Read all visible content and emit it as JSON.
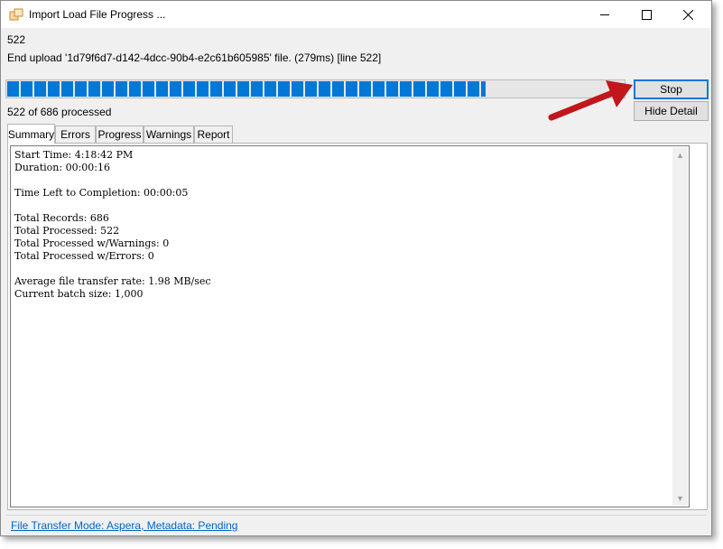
{
  "window": {
    "title": "Import Load File Progress ...",
    "icon": "app-window-icon",
    "controls": [
      "minimize-icon",
      "maximize-icon",
      "close-icon"
    ]
  },
  "status": {
    "count": "522",
    "message": "End upload '1d79f6d7-d142-4dcc-90b4-e2c61b605985' file. (279ms) [line 522]",
    "processed": "522 of 686 processed",
    "progress_fraction": 0.776,
    "progress_color": "#0078d7"
  },
  "buttons": {
    "stop": "Stop",
    "hide_detail": "Hide Detail"
  },
  "annotation": {
    "arrow_color": "#c0161c",
    "icon": "red-arrow-icon"
  },
  "tabs": [
    {
      "label": "Summary",
      "active": true
    },
    {
      "label": "Errors",
      "active": false
    },
    {
      "label": "Progress",
      "active": false
    },
    {
      "label": "Warnings",
      "active": false
    },
    {
      "label": "Report",
      "active": false
    }
  ],
  "summary": {
    "lines": [
      "Start Time: 4:18:42 PM",
      "Duration: 00:00:16",
      "",
      "Time Left to Completion: 00:00:05",
      "",
      "Total Records: 686",
      "Total Processed: 522",
      "Total Processed w/Warnings: 0",
      "Total Processed w/Errors: 0",
      "",
      "Average file transfer rate: 1.98 MB/sec",
      "Current batch size: 1,000"
    ]
  },
  "footer": {
    "link": "File Transfer Mode: Aspera, Metadata: Pending"
  }
}
